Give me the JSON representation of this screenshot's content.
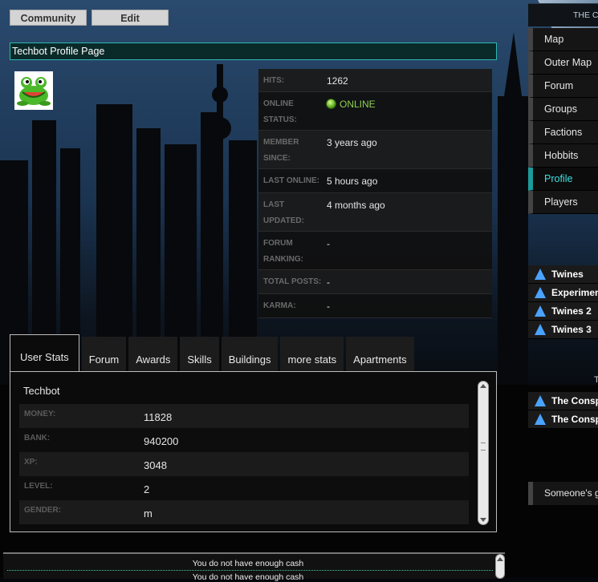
{
  "top_buttons": {
    "community": "Community",
    "edit": "Edit"
  },
  "page_title": "Techbot Profile Page",
  "avatar_icon": "frog-icon",
  "info": [
    {
      "label": "HITS:",
      "value": "1262"
    },
    {
      "label": "ONLINE STATUS:",
      "value": "ONLINE"
    },
    {
      "label": "MEMBER SINCE:",
      "value": "3 years ago"
    },
    {
      "label": "LAST ONLINE:",
      "value": "5 hours ago"
    },
    {
      "label": "LAST UPDATED:",
      "value": "4 months ago"
    },
    {
      "label": "FORUM RANKING:",
      "value": "-"
    },
    {
      "label": "TOTAL POSTS:",
      "value": "-"
    },
    {
      "label": "KARMA:",
      "value": "-"
    }
  ],
  "tabs": [
    "User Stats",
    "Forum",
    "Awards",
    "Skills",
    "Buildings",
    "more stats",
    "Apartments"
  ],
  "stats": {
    "username": "Techbot",
    "rows": [
      {
        "label": "MONEY:",
        "value": "11828"
      },
      {
        "label": "BANK:",
        "value": "940200"
      },
      {
        "label": "XP:",
        "value": "3048"
      },
      {
        "label": "LEVEL:",
        "value": "2"
      },
      {
        "label": "GENDER:",
        "value": "m"
      }
    ]
  },
  "messages": [
    "You do not have enough cash",
    "You do not have enough cash"
  ],
  "sidebar": {
    "header": "THE C",
    "nav": [
      "Map",
      "Outer Map",
      "Forum",
      "Groups",
      "Factions",
      "Hobbits",
      "Profile",
      "Players"
    ],
    "active": "Profile",
    "list1": [
      "Twines",
      "Experimen",
      "Twines 2",
      "Twines 3"
    ],
    "section_letter": "T",
    "list2": [
      "The Consp",
      "The Consp"
    ],
    "someone": "Someone's g"
  },
  "colors": {
    "accent": "#2fb7b0",
    "online": "#8fd14f",
    "active_nav": "#3ee0e0"
  }
}
